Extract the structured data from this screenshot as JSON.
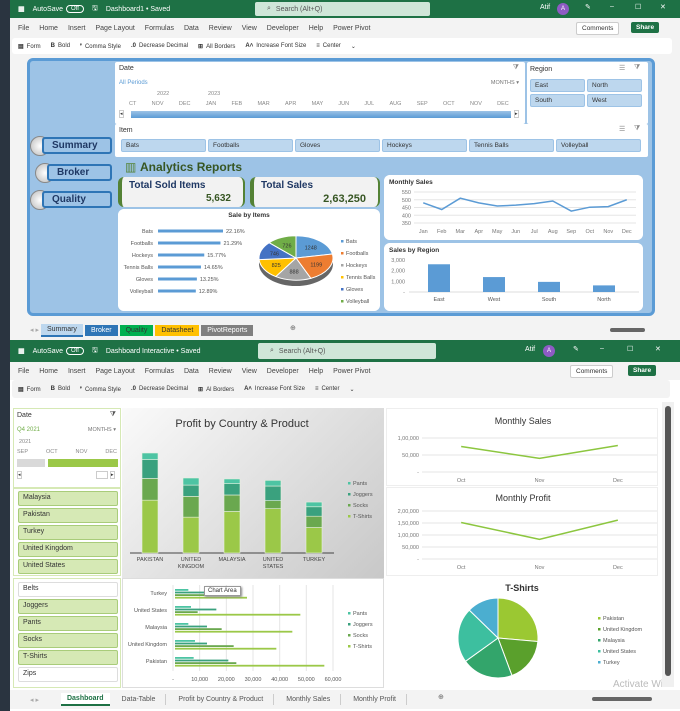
{
  "top_window": {
    "title": "Dashboard1 • Saved",
    "autosave_label": "AutoSave",
    "autosave_state": "Off",
    "search_placeholder": "Search (Alt+Q)",
    "user": "Atif",
    "avatar_initial": "A",
    "menu": [
      "File",
      "Home",
      "Insert",
      "Page Layout",
      "Formulas",
      "Data",
      "Review",
      "View",
      "Developer",
      "Help",
      "Power Pivot"
    ],
    "comments": "Comments",
    "share": "Share",
    "toolbar": [
      "Form",
      "Bold",
      "Comma Style",
      "Decrease Decimal",
      "All Borders",
      "Increase Font Size",
      "Center"
    ],
    "nav_buttons": [
      "Summary",
      "Broker",
      "Quality"
    ],
    "date_slicer": {
      "title": "Date",
      "period": "All Periods",
      "unit": "MONTHS",
      "years": [
        "2022",
        "2023"
      ],
      "months": [
        "CT",
        "NOV",
        "DEC",
        "JAN",
        "FEB",
        "MAR",
        "APR",
        "MAY",
        "JUN",
        "JUL",
        "AUG",
        "SEP",
        "OCT",
        "NOV",
        "DEC"
      ]
    },
    "region_slicer": {
      "title": "Region",
      "items": [
        "East",
        "North",
        "South",
        "West"
      ]
    },
    "item_slicer": {
      "title": "Item",
      "items": [
        "Bats",
        "Footballs",
        "Gloves",
        "Hockeys",
        "Tennis Balls",
        "Volleyball"
      ]
    },
    "report_title": "Analytics Reports",
    "kpis": [
      {
        "label": "Total Sold Items",
        "value": "5,632"
      },
      {
        "label": "Total Sales",
        "value": "2,63,250"
      }
    ],
    "sheet_tabs": [
      {
        "label": "Summary",
        "color": "#bdd7ee"
      },
      {
        "label": "Broker",
        "color": "#2e75b6"
      },
      {
        "label": "Quality",
        "color": "#00b050"
      },
      {
        "label": "Datasheet",
        "color": "#ffc000"
      },
      {
        "label": "PivotReports",
        "color": "#7f7f7f"
      }
    ]
  },
  "bottom_window": {
    "title": "Dashboard Interactive • Saved",
    "autosave_label": "AutoSave",
    "autosave_state": "Off",
    "search_placeholder": "Search (Alt+Q)",
    "user": "Atif",
    "avatar_initial": "A",
    "menu": [
      "File",
      "Home",
      "Insert",
      "Page Layout",
      "Formulas",
      "Data",
      "Review",
      "View",
      "Developer",
      "Help",
      "Power Pivot"
    ],
    "comments": "Comments",
    "share": "Share",
    "toolbar": [
      "Form",
      "Bold",
      "Comma Style",
      "Decrease Decimal",
      "Al Borders",
      "Increase Font Size",
      "Center"
    ],
    "date_slicer": {
      "title": "Date",
      "period": "Q4 2021",
      "unit": "MONTHS",
      "year": "2021",
      "months": [
        "SEP",
        "OCT",
        "NOV",
        "DEC"
      ]
    },
    "country_slicer": [
      "Malaysia",
      "Pakistan",
      "Turkey",
      "United Kingdom",
      "United States"
    ],
    "product_slicer": [
      {
        "label": "Belts",
        "selected": false
      },
      {
        "label": "Joggers",
        "selected": true
      },
      {
        "label": "Pants",
        "selected": true
      },
      {
        "label": "Socks",
        "selected": true
      },
      {
        "label": "T-Shirts",
        "selected": true
      },
      {
        "label": "Zips",
        "selected": false
      }
    ],
    "tooltip": "Chart Area",
    "watermark": "Activate Wi",
    "sheet_tabs": [
      "Dashboard",
      "Data-Table",
      "Profit by Country & Product",
      "Monthly Sales",
      "Monthly Profit"
    ]
  },
  "chart_data": [
    {
      "id": "sale-by-items-bar",
      "type": "bar",
      "title": "Sale by Items",
      "categories": [
        "Bats",
        "Footballs",
        "Hockeys",
        "Tennis Balls",
        "Gloves",
        "Volleyball"
      ],
      "values": [
        22.16,
        21.29,
        15.77,
        14.65,
        13.25,
        12.89
      ],
      "labels": [
        "22.16%",
        "21.29%",
        "15.77%",
        "14.65%",
        "13.25%",
        "12.89%"
      ],
      "color": "#5b9bd5"
    },
    {
      "id": "sale-by-items-pie",
      "type": "pie",
      "categories": [
        "Bats",
        "Footballs",
        "Hockeys",
        "Tennis Balls",
        "Gloves",
        "Volleyball"
      ],
      "values": [
        1248,
        1199,
        888,
        825,
        746,
        726
      ],
      "colors": [
        "#5b9bd5",
        "#ed7d31",
        "#a5a5a5",
        "#ffc000",
        "#4472c4",
        "#70ad47"
      ],
      "legend": "right"
    },
    {
      "id": "monthly-sales-top",
      "type": "line",
      "title": "Monthly Sales",
      "categories": [
        "Jan",
        "Feb",
        "Mar",
        "Apr",
        "May",
        "Jun",
        "Jul",
        "Aug",
        "Sep",
        "Oct",
        "Nov",
        "Dec"
      ],
      "values": [
        480,
        437,
        510,
        480,
        460,
        465,
        475,
        492,
        427,
        452,
        456,
        500
      ],
      "ylim": [
        350,
        550
      ],
      "yticks": [
        "550",
        "500",
        "450",
        "400",
        "350"
      ],
      "color": "#5b9bd5"
    },
    {
      "id": "sales-by-region",
      "type": "bar",
      "title": "Sales by Region",
      "categories": [
        "East",
        "West",
        "South",
        "North"
      ],
      "values": [
        2600,
        1400,
        950,
        620
      ],
      "ylim": [
        0,
        3000
      ],
      "yticks": [
        "3,000",
        "2,000",
        "1,000",
        "-"
      ],
      "color": "#5b9bd5"
    },
    {
      "id": "profit-country-product",
      "type": "bar",
      "title": "Profit by Country & Product",
      "stacked": true,
      "categories": [
        "PAKISTAN",
        "UNITED KINGDOM",
        "MALAYSIA",
        "UNITED STATES",
        "TURKEY"
      ],
      "series": [
        {
          "name": "T-Shirts",
          "values": [
            56000,
            38000,
            44000,
            47000,
            27000
          ],
          "color": "#9bc848"
        },
        {
          "name": "Socks",
          "values": [
            23000,
            22000,
            17500,
            8500,
            12000
          ],
          "color": "#6aa84f"
        },
        {
          "name": "Joggers",
          "values": [
            20000,
            12000,
            12000,
            15500,
            10000
          ],
          "color": "#3aa17e"
        },
        {
          "name": "Pants",
          "values": [
            7000,
            7500,
            5000,
            6000,
            5000
          ],
          "color": "#4dc4a3"
        }
      ],
      "legend": "right"
    },
    {
      "id": "monthly-sales-bottom",
      "type": "line",
      "title": "Monthly Sales",
      "categories": [
        "Oct",
        "Nov",
        "Dec"
      ],
      "values": [
        75000,
        40000,
        78000
      ],
      "ylim": [
        0,
        100000
      ],
      "yticks": [
        "1,00,000",
        "50,000",
        "-"
      ],
      "color": "#8cc63f"
    },
    {
      "id": "monthly-profit",
      "type": "line",
      "title": "Monthly Profit",
      "categories": [
        "Oct",
        "Nov",
        "Dec"
      ],
      "values": [
        152000,
        82000,
        162000
      ],
      "ylim": [
        0,
        200000
      ],
      "yticks": [
        "2,00,000",
        "1,50,000",
        "1,00,000",
        "50,000",
        "-"
      ],
      "color": "#8cc63f"
    },
    {
      "id": "profit-horizontal",
      "type": "bar",
      "orientation": "horizontal",
      "categories": [
        "Turkey",
        "United States",
        "Malaysia",
        "United Kingdom",
        "Pakistan"
      ],
      "series": [
        {
          "name": "Pants",
          "values": [
            5000,
            6000,
            5000,
            7500,
            7000
          ],
          "color": "#4dc4a3"
        },
        {
          "name": "Joggers",
          "values": [
            12000,
            15500,
            12000,
            12000,
            20000
          ],
          "color": "#3aa17e"
        },
        {
          "name": "Socks",
          "values": [
            12000,
            8500,
            17500,
            22000,
            23000
          ],
          "color": "#6aa84f"
        },
        {
          "name": "T-Shirts",
          "values": [
            27000,
            47000,
            44000,
            38000,
            56000
          ],
          "color": "#9bc848"
        }
      ],
      "xlim": [
        0,
        60000
      ],
      "xticks": [
        "-",
        "10,000",
        "20,000",
        "30,000",
        "40,000",
        "50,000",
        "60,000"
      ],
      "legend": "right"
    },
    {
      "id": "tshirts-pie",
      "type": "pie",
      "title": "T-Shirts",
      "categories": [
        "Pakistan",
        "United Kingdom",
        "Malaysia",
        "United States",
        "Turkey"
      ],
      "values": [
        56000,
        38000,
        44000,
        47000,
        27000
      ],
      "colors": [
        "#9bc832",
        "#5aa02c",
        "#33a56b",
        "#3dbf9f",
        "#4baed0"
      ],
      "legend": "right"
    }
  ]
}
